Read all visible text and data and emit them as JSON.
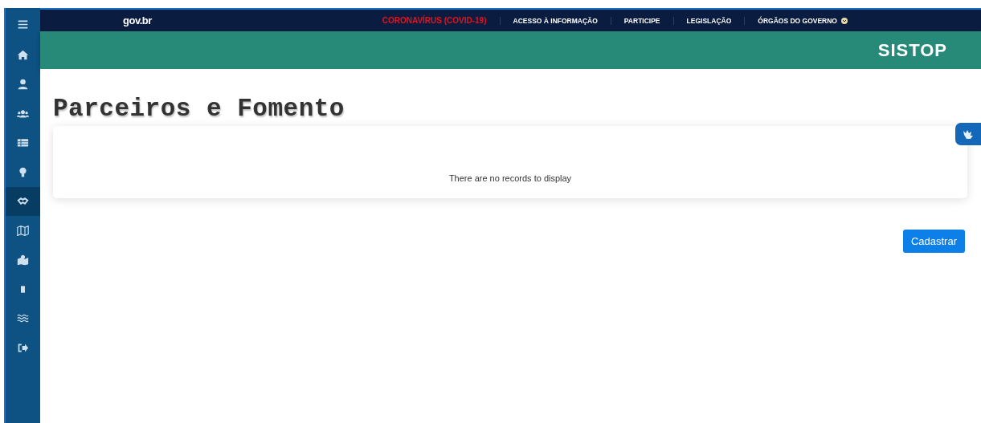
{
  "sidebar": {
    "items": [
      {
        "kind": "menu",
        "selected": false
      },
      {
        "kind": "home",
        "selected": false
      },
      {
        "kind": "user",
        "selected": false
      },
      {
        "kind": "users",
        "selected": false
      },
      {
        "kind": "table",
        "selected": false
      },
      {
        "kind": "bulb",
        "selected": false
      },
      {
        "kind": "handshake",
        "selected": true
      },
      {
        "kind": "map",
        "selected": false
      },
      {
        "kind": "mapuser",
        "selected": false
      },
      {
        "kind": "door",
        "selected": false
      },
      {
        "kind": "waves",
        "selected": false
      },
      {
        "kind": "logout",
        "selected": false
      }
    ]
  },
  "gov_bar": {
    "logo": "gov.br",
    "links": [
      {
        "label": "CORONAVÍRUS (COVID-19)",
        "kind": "alert"
      },
      {
        "label": "ACESSO À INFORMAÇÃO",
        "kind": "plain"
      },
      {
        "label": "PARTICIPE",
        "kind": "plain"
      },
      {
        "label": "LEGISLAÇÃO",
        "kind": "plain"
      },
      {
        "label": "ÓRGÃOS DO GOVERNO",
        "kind": "dropdown"
      }
    ]
  },
  "header": {
    "title": "SISTOP"
  },
  "page": {
    "title": "Parceiros e Fomento",
    "table": {
      "empty_message": "There are no records to display"
    },
    "buttons": [
      "Cadastrar"
    ]
  }
}
